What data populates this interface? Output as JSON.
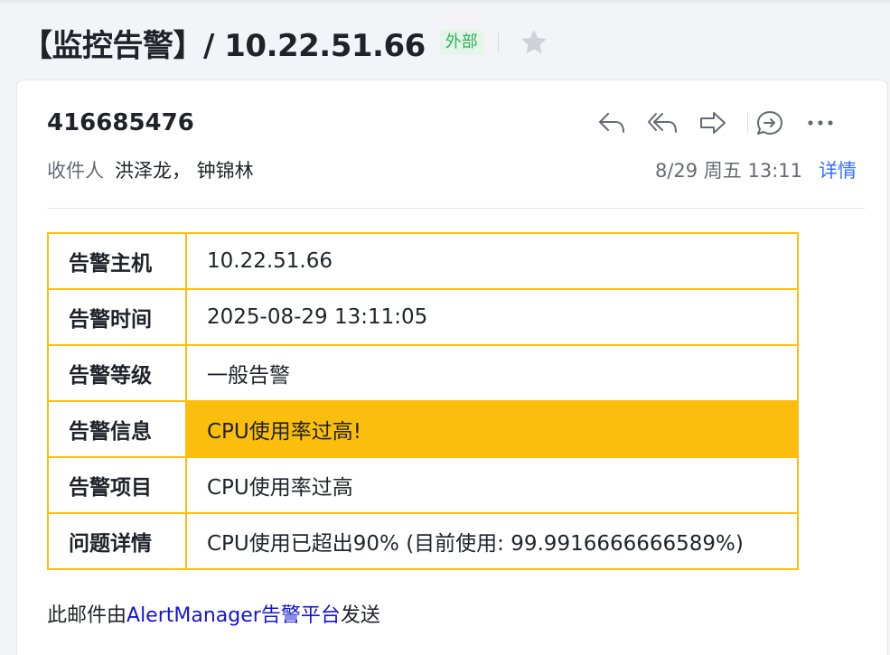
{
  "email": {
    "subject": "【监控告警】/ 10.22.51.66",
    "external_tag": "外部",
    "sender": "416685476",
    "recipients_label": "收件人",
    "recipients": "洪泽龙， 钟锦林",
    "date": "8/29 周五 13:11",
    "details_link": "详情",
    "icons": {
      "star": "star-icon",
      "reply": "reply-icon",
      "reply_all": "reply-all-icon",
      "forward": "forward-icon",
      "comment": "comment-icon",
      "more": "more-icon"
    }
  },
  "alert_table": {
    "rows": [
      {
        "key": "告警主机",
        "value": "10.22.51.66",
        "highlight": false
      },
      {
        "key": "告警时间",
        "value": "2025-08-29 13:11:05",
        "highlight": false
      },
      {
        "key": "告警等级",
        "value": "一般告警",
        "highlight": false
      },
      {
        "key": "告警信息",
        "value": "CPU使用率过高!",
        "highlight": true
      },
      {
        "key": "告警项目",
        "value": "CPU使用率过高",
        "highlight": false
      },
      {
        "key": "问题详情",
        "value": "CPU使用已超出90% (目前使用: 99.9916666666589%)",
        "highlight": false
      }
    ]
  },
  "footer": {
    "prefix": "此邮件由",
    "link": "AlertManager告警平台",
    "suffix": "发送"
  },
  "colors": {
    "table_border": "#fbbe0c",
    "highlight": "#fbbe0c",
    "link_blue": "#3370ff",
    "footer_link": "#1414d6",
    "tag_green": "#2fb25b"
  }
}
